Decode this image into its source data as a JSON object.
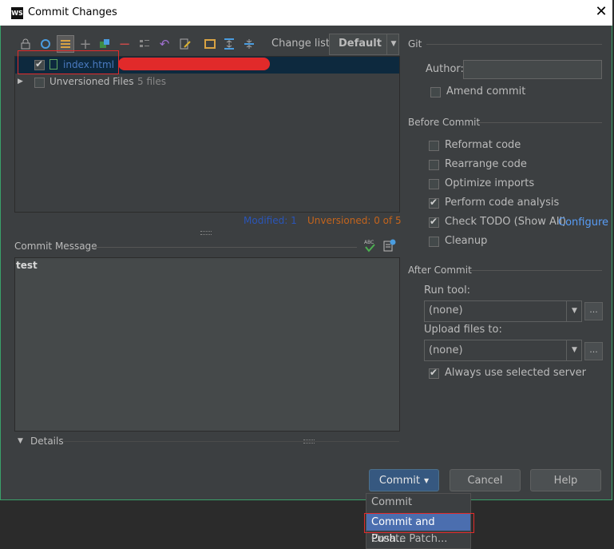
{
  "window": {
    "title": "Commit Changes",
    "app_logo": "WS",
    "close_icon": "close-icon"
  },
  "toolbar": {
    "change_list_label": "Change list:",
    "change_list_value": "Default",
    "icons": [
      "lock-icon",
      "refresh-icon",
      "group-icon",
      "add-icon",
      "move-icon",
      "remove-icon",
      "diff-icon",
      "revert-icon",
      "edit-icon",
      "changelist-icon",
      "expand-all-icon",
      "collapse-all-icon"
    ]
  },
  "tree": {
    "file_name": "index.html",
    "unversioned_label": "Unversioned Files",
    "unversioned_count": "5 files",
    "status_modified": "Modified: 1",
    "status_unversioned": "Unversioned: 0 of 5"
  },
  "commit_message": {
    "label": "Commit Message",
    "text": "test"
  },
  "git": {
    "section": "Git",
    "author_label": "Author:",
    "author_value": "",
    "amend_commit": "Amend commit"
  },
  "before_commit": {
    "section": "Before Commit",
    "options": [
      {
        "label": "Reformat code",
        "checked": false
      },
      {
        "label": "Rearrange code",
        "checked": false
      },
      {
        "label": "Optimize imports",
        "checked": false
      },
      {
        "label": "Perform code analysis",
        "checked": true
      },
      {
        "label": "Check TODO (Show All)",
        "checked": true
      },
      {
        "label": "Cleanup",
        "checked": false
      }
    ],
    "configure_link": "Configure"
  },
  "after_commit": {
    "section": "After Commit",
    "run_tool_label": "Run tool:",
    "run_tool_value": "(none)",
    "upload_label": "Upload files to:",
    "upload_value": "(none)",
    "dots": "...",
    "always_use_server": "Always use selected server",
    "always_use_server_checked": true
  },
  "details": {
    "label": "Details"
  },
  "buttons": {
    "commit": "Commit",
    "cancel": "Cancel",
    "help": "Help"
  },
  "menu": {
    "items": [
      "Commit",
      "Commit and Push...",
      "Create Patch..."
    ],
    "selected": "Commit and Push..."
  },
  "colors": {
    "dialog_bg": "#3c3f41",
    "selection": "#0d293e",
    "accent_link": "#589df6",
    "commit_button": "#365880",
    "menu_highlight": "#4b6eaf",
    "annotation_red": "#e32b2b"
  }
}
